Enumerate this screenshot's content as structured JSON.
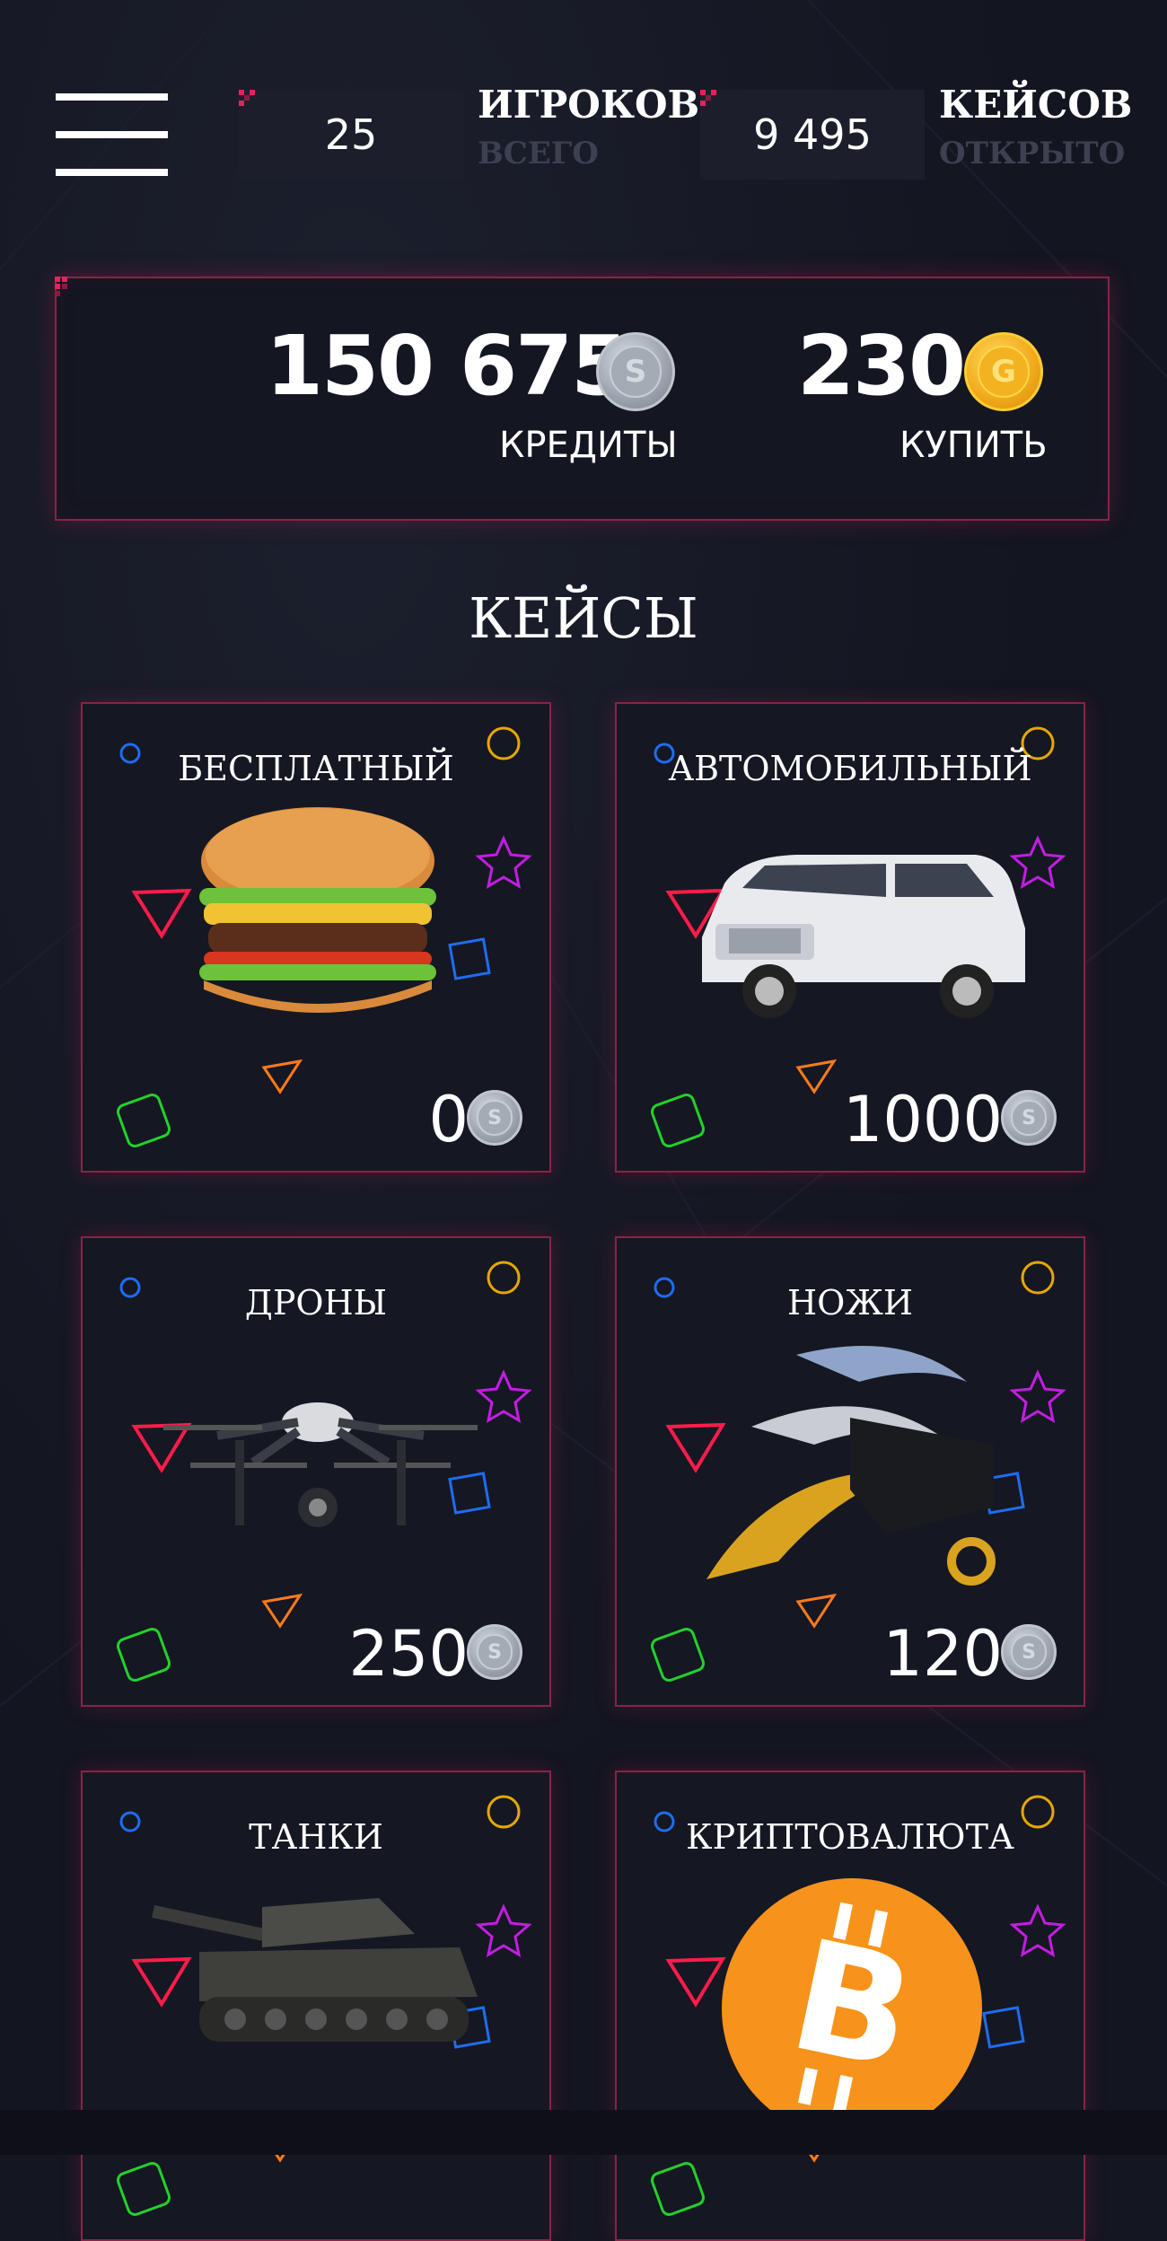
{
  "header": {
    "menu_icon": "hamburger-icon",
    "players": {
      "value": "25",
      "label_top": "ИГРОКОВ",
      "label_bottom": "ВСЕГО"
    },
    "cases": {
      "value": "9 495",
      "label_top": "КЕЙСОВ",
      "label_bottom": "ОТКРЫТО"
    }
  },
  "balance": {
    "credits": {
      "amount": "150 675",
      "label": "КРЕДИТЫ",
      "coin_letter": "S",
      "coin_icon": "silver-coin-icon"
    },
    "gold": {
      "amount": "230",
      "label": "КУПИТЬ",
      "coin_letter": "G",
      "coin_icon": "gold-coin-icon"
    }
  },
  "section_title": "КЕЙСЫ",
  "cases": [
    {
      "title": "БЕСПЛАТНЫЙ",
      "price": "0",
      "image": "burger-image"
    },
    {
      "title": "АВТОМОБИЛЬНЫЙ",
      "price": "1000",
      "image": "car-image"
    },
    {
      "title": "ДРОНЫ",
      "price": "250",
      "image": "drone-image"
    },
    {
      "title": "НОЖИ",
      "price": "120",
      "image": "knives-image"
    },
    {
      "title": "ТАНКИ",
      "price": "",
      "image": "tank-image"
    },
    {
      "title": "КРИПТОВАЛЮТА",
      "price": "",
      "image": "bitcoin-image"
    }
  ],
  "colors": {
    "background": "#141621",
    "accent": "#e0245e",
    "panel_border": "#8a2346",
    "muted_text": "#3c4050"
  }
}
